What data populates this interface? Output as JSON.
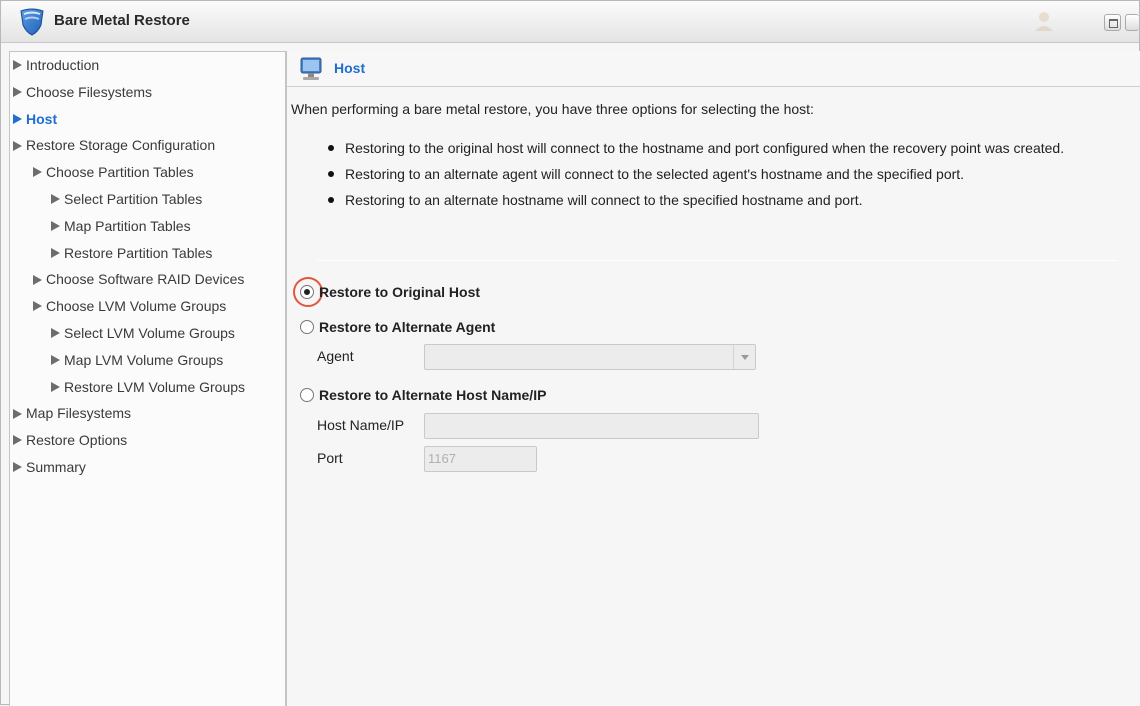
{
  "window": {
    "title": "Bare Metal Restore"
  },
  "sidebar": {
    "items": [
      {
        "label": "Introduction",
        "indent": 0,
        "active": false
      },
      {
        "label": "Choose Filesystems",
        "indent": 0,
        "active": false
      },
      {
        "label": "Host",
        "indent": 0,
        "active": true
      },
      {
        "label": "Restore Storage Configuration",
        "indent": 0,
        "active": false
      },
      {
        "label": "Choose Partition Tables",
        "indent": 1,
        "active": false
      },
      {
        "label": "Select Partition Tables",
        "indent": 2,
        "active": false
      },
      {
        "label": "Map Partition Tables",
        "indent": 2,
        "active": false
      },
      {
        "label": "Restore Partition Tables",
        "indent": 2,
        "active": false
      },
      {
        "label": "Choose Software RAID Devices",
        "indent": 1,
        "active": false
      },
      {
        "label": "Choose LVM Volume Groups",
        "indent": 1,
        "active": false
      },
      {
        "label": "Select LVM Volume Groups",
        "indent": 2,
        "active": false
      },
      {
        "label": "Map LVM Volume Groups",
        "indent": 2,
        "active": false
      },
      {
        "label": "Restore LVM Volume Groups",
        "indent": 2,
        "active": false
      },
      {
        "label": "Map Filesystems",
        "indent": 0,
        "active": false
      },
      {
        "label": "Restore Options",
        "indent": 0,
        "active": false
      },
      {
        "label": "Summary",
        "indent": 0,
        "active": false
      }
    ]
  },
  "content": {
    "section_title": "Host",
    "intro": "When performing a bare metal restore, you have three options for selecting the host:",
    "bullets": [
      "Restoring to the original host will connect to the hostname and port configured when the recovery point was created.",
      "Restoring to an alternate agent will connect to the selected agent's hostname and the specified port.",
      "Restoring to an alternate hostname will connect to the specified hostname and port."
    ],
    "options": {
      "original": {
        "label": "Restore to Original Host",
        "checked": true
      },
      "alternate_agent": {
        "label": "Restore to Alternate Agent",
        "checked": false
      },
      "alternate_host": {
        "label": "Restore to Alternate Host Name/IP",
        "checked": false
      }
    },
    "agent_label": "Agent",
    "agent_value": "",
    "hostname_label": "Host Name/IP",
    "hostname_value": "",
    "port_label": "Port",
    "port_value": "1167"
  },
  "colors": {
    "accent": "#1e6fd0",
    "highlight_ring": "#e0583a"
  },
  "icons": {
    "app": "shield-icon",
    "section": "monitor-icon"
  }
}
